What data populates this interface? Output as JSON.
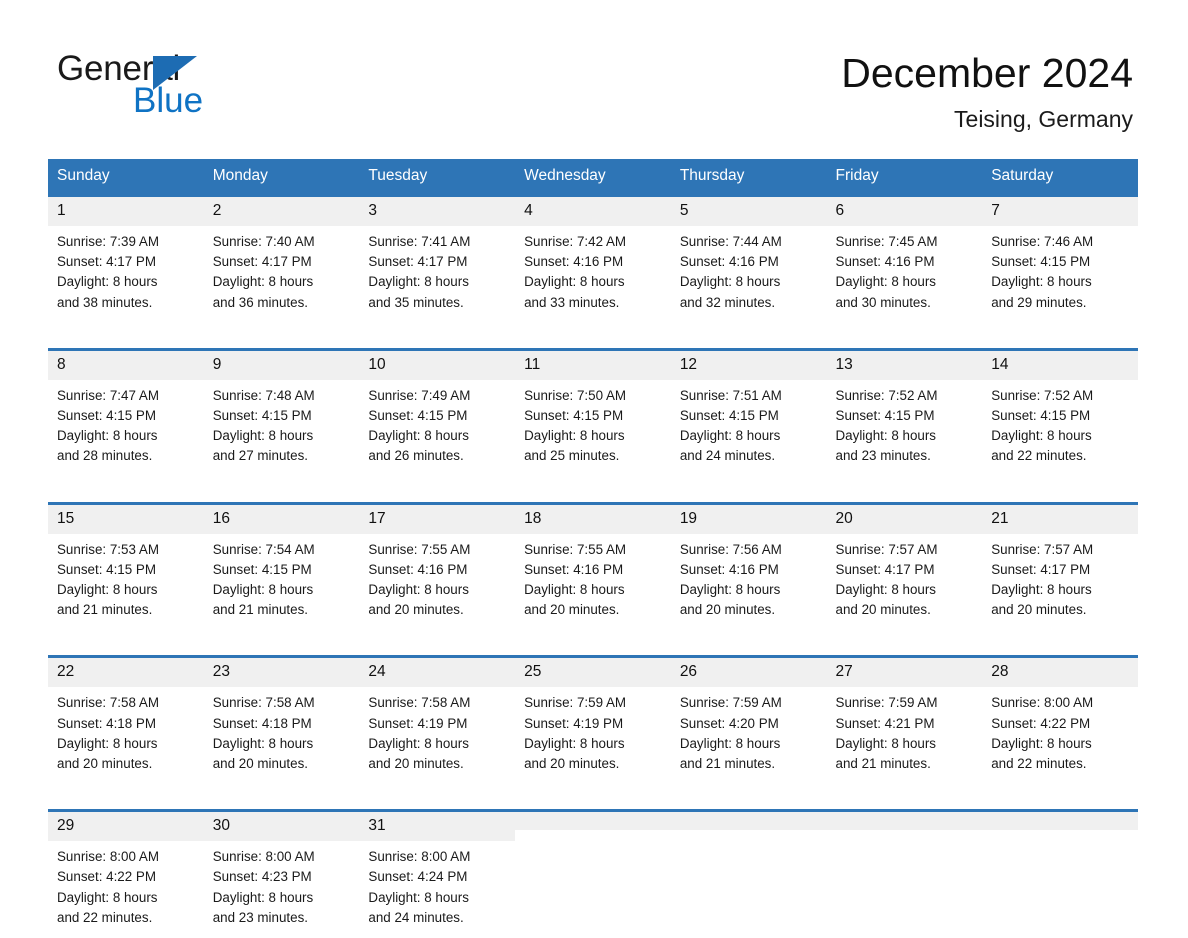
{
  "brand": {
    "line1": "General",
    "line2": "Blue",
    "triangle_color": "#1d6cb3",
    "blue_color": "#0f73c4"
  },
  "header": {
    "title": "December 2024",
    "location": "Teising, Germany"
  },
  "colors": {
    "header_blue": "#2e75b6",
    "daynum_band": "#f0f0f0",
    "text": "#1a1a1a"
  },
  "weekday_headers": [
    "Sunday",
    "Monday",
    "Tuesday",
    "Wednesday",
    "Thursday",
    "Friday",
    "Saturday"
  ],
  "weeks": [
    [
      {
        "day": "1",
        "sunrise": "Sunrise: 7:39 AM",
        "sunset": "Sunset: 4:17 PM",
        "daylight1": "Daylight: 8 hours",
        "daylight2": "and 38 minutes."
      },
      {
        "day": "2",
        "sunrise": "Sunrise: 7:40 AM",
        "sunset": "Sunset: 4:17 PM",
        "daylight1": "Daylight: 8 hours",
        "daylight2": "and 36 minutes."
      },
      {
        "day": "3",
        "sunrise": "Sunrise: 7:41 AM",
        "sunset": "Sunset: 4:17 PM",
        "daylight1": "Daylight: 8 hours",
        "daylight2": "and 35 minutes."
      },
      {
        "day": "4",
        "sunrise": "Sunrise: 7:42 AM",
        "sunset": "Sunset: 4:16 PM",
        "daylight1": "Daylight: 8 hours",
        "daylight2": "and 33 minutes."
      },
      {
        "day": "5",
        "sunrise": "Sunrise: 7:44 AM",
        "sunset": "Sunset: 4:16 PM",
        "daylight1": "Daylight: 8 hours",
        "daylight2": "and 32 minutes."
      },
      {
        "day": "6",
        "sunrise": "Sunrise: 7:45 AM",
        "sunset": "Sunset: 4:16 PM",
        "daylight1": "Daylight: 8 hours",
        "daylight2": "and 30 minutes."
      },
      {
        "day": "7",
        "sunrise": "Sunrise: 7:46 AM",
        "sunset": "Sunset: 4:15 PM",
        "daylight1": "Daylight: 8 hours",
        "daylight2": "and 29 minutes."
      }
    ],
    [
      {
        "day": "8",
        "sunrise": "Sunrise: 7:47 AM",
        "sunset": "Sunset: 4:15 PM",
        "daylight1": "Daylight: 8 hours",
        "daylight2": "and 28 minutes."
      },
      {
        "day": "9",
        "sunrise": "Sunrise: 7:48 AM",
        "sunset": "Sunset: 4:15 PM",
        "daylight1": "Daylight: 8 hours",
        "daylight2": "and 27 minutes."
      },
      {
        "day": "10",
        "sunrise": "Sunrise: 7:49 AM",
        "sunset": "Sunset: 4:15 PM",
        "daylight1": "Daylight: 8 hours",
        "daylight2": "and 26 minutes."
      },
      {
        "day": "11",
        "sunrise": "Sunrise: 7:50 AM",
        "sunset": "Sunset: 4:15 PM",
        "daylight1": "Daylight: 8 hours",
        "daylight2": "and 25 minutes."
      },
      {
        "day": "12",
        "sunrise": "Sunrise: 7:51 AM",
        "sunset": "Sunset: 4:15 PM",
        "daylight1": "Daylight: 8 hours",
        "daylight2": "and 24 minutes."
      },
      {
        "day": "13",
        "sunrise": "Sunrise: 7:52 AM",
        "sunset": "Sunset: 4:15 PM",
        "daylight1": "Daylight: 8 hours",
        "daylight2": "and 23 minutes."
      },
      {
        "day": "14",
        "sunrise": "Sunrise: 7:52 AM",
        "sunset": "Sunset: 4:15 PM",
        "daylight1": "Daylight: 8 hours",
        "daylight2": "and 22 minutes."
      }
    ],
    [
      {
        "day": "15",
        "sunrise": "Sunrise: 7:53 AM",
        "sunset": "Sunset: 4:15 PM",
        "daylight1": "Daylight: 8 hours",
        "daylight2": "and 21 minutes."
      },
      {
        "day": "16",
        "sunrise": "Sunrise: 7:54 AM",
        "sunset": "Sunset: 4:15 PM",
        "daylight1": "Daylight: 8 hours",
        "daylight2": "and 21 minutes."
      },
      {
        "day": "17",
        "sunrise": "Sunrise: 7:55 AM",
        "sunset": "Sunset: 4:16 PM",
        "daylight1": "Daylight: 8 hours",
        "daylight2": "and 20 minutes."
      },
      {
        "day": "18",
        "sunrise": "Sunrise: 7:55 AM",
        "sunset": "Sunset: 4:16 PM",
        "daylight1": "Daylight: 8 hours",
        "daylight2": "and 20 minutes."
      },
      {
        "day": "19",
        "sunrise": "Sunrise: 7:56 AM",
        "sunset": "Sunset: 4:16 PM",
        "daylight1": "Daylight: 8 hours",
        "daylight2": "and 20 minutes."
      },
      {
        "day": "20",
        "sunrise": "Sunrise: 7:57 AM",
        "sunset": "Sunset: 4:17 PM",
        "daylight1": "Daylight: 8 hours",
        "daylight2": "and 20 minutes."
      },
      {
        "day": "21",
        "sunrise": "Sunrise: 7:57 AM",
        "sunset": "Sunset: 4:17 PM",
        "daylight1": "Daylight: 8 hours",
        "daylight2": "and 20 minutes."
      }
    ],
    [
      {
        "day": "22",
        "sunrise": "Sunrise: 7:58 AM",
        "sunset": "Sunset: 4:18 PM",
        "daylight1": "Daylight: 8 hours",
        "daylight2": "and 20 minutes."
      },
      {
        "day": "23",
        "sunrise": "Sunrise: 7:58 AM",
        "sunset": "Sunset: 4:18 PM",
        "daylight1": "Daylight: 8 hours",
        "daylight2": "and 20 minutes."
      },
      {
        "day": "24",
        "sunrise": "Sunrise: 7:58 AM",
        "sunset": "Sunset: 4:19 PM",
        "daylight1": "Daylight: 8 hours",
        "daylight2": "and 20 minutes."
      },
      {
        "day": "25",
        "sunrise": "Sunrise: 7:59 AM",
        "sunset": "Sunset: 4:19 PM",
        "daylight1": "Daylight: 8 hours",
        "daylight2": "and 20 minutes."
      },
      {
        "day": "26",
        "sunrise": "Sunrise: 7:59 AM",
        "sunset": "Sunset: 4:20 PM",
        "daylight1": "Daylight: 8 hours",
        "daylight2": "and 21 minutes."
      },
      {
        "day": "27",
        "sunrise": "Sunrise: 7:59 AM",
        "sunset": "Sunset: 4:21 PM",
        "daylight1": "Daylight: 8 hours",
        "daylight2": "and 21 minutes."
      },
      {
        "day": "28",
        "sunrise": "Sunrise: 8:00 AM",
        "sunset": "Sunset: 4:22 PM",
        "daylight1": "Daylight: 8 hours",
        "daylight2": "and 22 minutes."
      }
    ],
    [
      {
        "day": "29",
        "sunrise": "Sunrise: 8:00 AM",
        "sunset": "Sunset: 4:22 PM",
        "daylight1": "Daylight: 8 hours",
        "daylight2": "and 22 minutes."
      },
      {
        "day": "30",
        "sunrise": "Sunrise: 8:00 AM",
        "sunset": "Sunset: 4:23 PM",
        "daylight1": "Daylight: 8 hours",
        "daylight2": "and 23 minutes."
      },
      {
        "day": "31",
        "sunrise": "Sunrise: 8:00 AM",
        "sunset": "Sunset: 4:24 PM",
        "daylight1": "Daylight: 8 hours",
        "daylight2": "and 24 minutes."
      },
      {
        "day": "",
        "sunrise": "",
        "sunset": "",
        "daylight1": "",
        "daylight2": ""
      },
      {
        "day": "",
        "sunrise": "",
        "sunset": "",
        "daylight1": "",
        "daylight2": ""
      },
      {
        "day": "",
        "sunrise": "",
        "sunset": "",
        "daylight1": "",
        "daylight2": ""
      },
      {
        "day": "",
        "sunrise": "",
        "sunset": "",
        "daylight1": "",
        "daylight2": ""
      }
    ]
  ]
}
